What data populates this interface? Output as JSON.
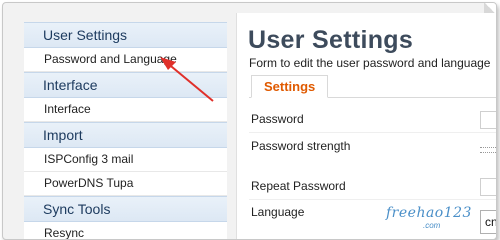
{
  "sidebar": {
    "sections": [
      {
        "title": "User Settings",
        "items": [
          "Password and Language"
        ]
      },
      {
        "title": "Interface",
        "items": [
          "Interface"
        ]
      },
      {
        "title": "Import",
        "items": [
          "ISPConfig 3 mail",
          "PowerDNS Tupa"
        ]
      },
      {
        "title": "Sync Tools",
        "items": [
          "Resync"
        ]
      }
    ]
  },
  "main": {
    "title": "User Settings",
    "subtitle": "Form to edit the user password and language",
    "tabs": [
      {
        "label": "Settings"
      }
    ],
    "fields": {
      "password": "Password",
      "password_strength": "Password strength",
      "repeat_password": "Repeat Password",
      "language": "Language",
      "language_value": "cn"
    }
  },
  "watermark": {
    "text": "freehao123",
    "sub": ".com"
  },
  "colors": {
    "annotation_arrow": "#e0302a",
    "tab_active": "#e05a00",
    "sidebar_header_bg": "#dde8f4"
  }
}
